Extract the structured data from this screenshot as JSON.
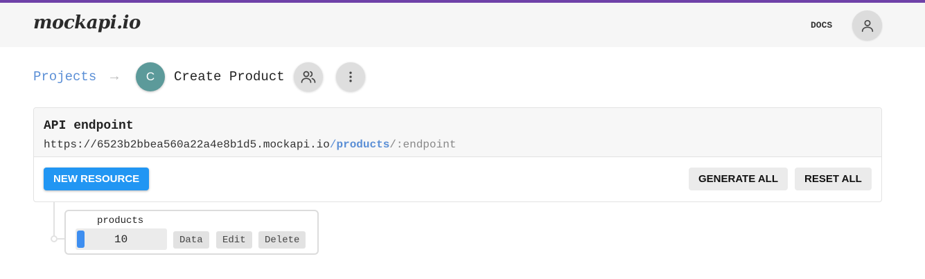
{
  "header": {
    "logo": "mockapi.io",
    "docs_label": "DOCS",
    "accent_color": "#6f42a8"
  },
  "breadcrumb": {
    "projects_label": "Projects",
    "arrow": "→",
    "avatar_letter": "C",
    "project_name": "Create Product"
  },
  "endpoint": {
    "title": "API endpoint",
    "base_url": "https://6523b2bbea560a22a4e8b1d5.mockapi.io",
    "slash": "/",
    "resource": "products",
    "suffix": "/:endpoint"
  },
  "actions": {
    "new_resource": "NEW RESOURCE",
    "generate_all": "GENERATE ALL",
    "reset_all": "RESET ALL"
  },
  "resources": [
    {
      "name": "products",
      "count": "10",
      "buttons": {
        "data": "Data",
        "edit": "Edit",
        "delete": "Delete"
      }
    }
  ]
}
